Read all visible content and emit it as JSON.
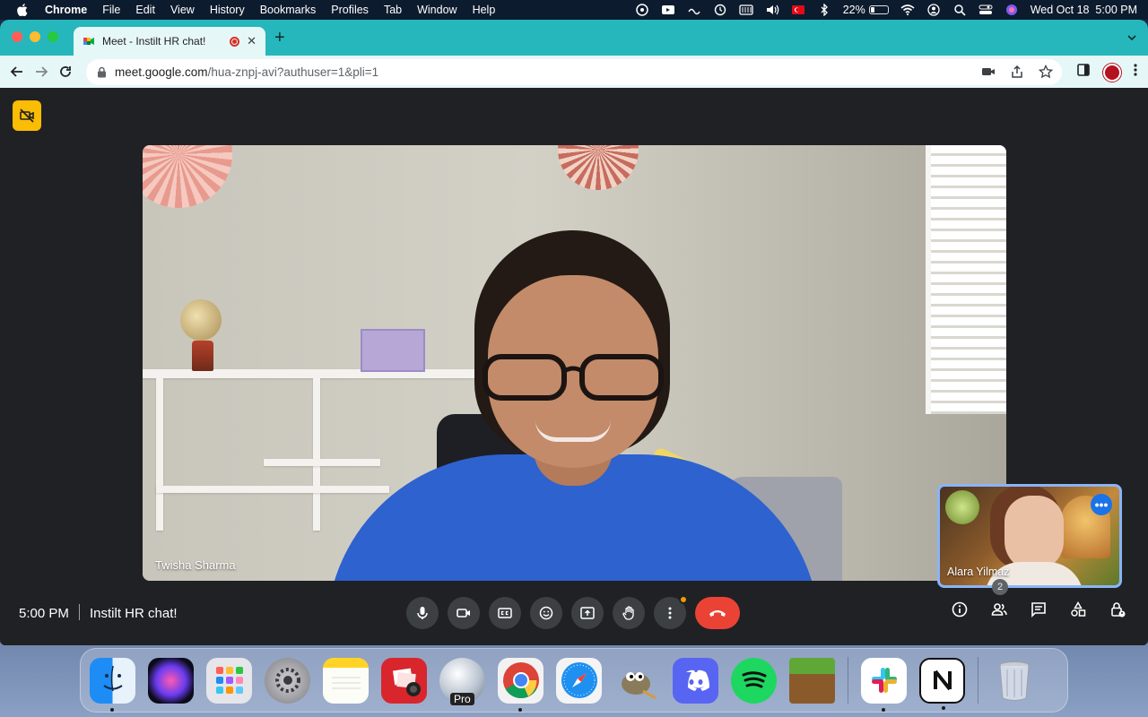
{
  "menubar": {
    "app_name": "Chrome",
    "menus": [
      "File",
      "Edit",
      "View",
      "History",
      "Bookmarks",
      "Profiles",
      "Tab",
      "Window",
      "Help"
    ],
    "battery_percent": "22%",
    "battery_level": 0.22,
    "datetime": "Wed Oct 18  5:00 PM"
  },
  "browser": {
    "tab_title": "Meet - Instilt HR chat!",
    "url_host": "meet.google.com",
    "url_path": "/hua-znpj-avi?authuser=1&pli=1",
    "tab_bar_color": "#26b7bc"
  },
  "meet": {
    "main_participant": "Twisha Sharma",
    "self_participant": "Alara Yilmaz",
    "time": "5:00 PM",
    "separator": "|",
    "meeting_title": "Instilt HR chat!",
    "people_count": "2",
    "accent_color": "#8ab4f8",
    "end_call_color": "#ea4335"
  },
  "dock": {
    "apps": [
      "finder-icon",
      "siri-icon",
      "launchpad-icon",
      "system-settings-icon",
      "notes-icon",
      "photo-booth-icon",
      "google-earth-pro-icon",
      "chrome-icon",
      "safari-icon",
      "gimp-icon",
      "discord-icon",
      "spotify-icon",
      "minecraft-icon",
      "slack-icon",
      "notion-icon",
      "trash-icon"
    ],
    "earth_badge": "Pro"
  }
}
